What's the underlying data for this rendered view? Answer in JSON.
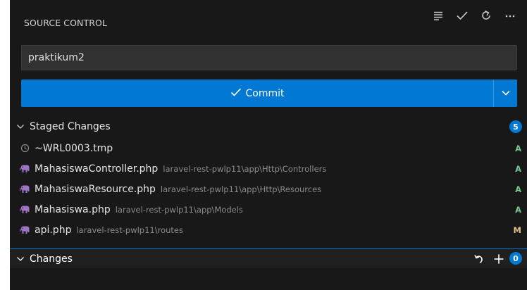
{
  "header": {
    "title": "SOURCE CONTROL",
    "actions": [
      "view-as-list-icon",
      "commit-check-icon",
      "refresh-icon",
      "more-actions-icon"
    ]
  },
  "commit_message": {
    "value": "praktikum2",
    "placeholder": ""
  },
  "commit_button": {
    "label": "Commit"
  },
  "staged": {
    "label": "Staged Changes",
    "count": "5",
    "files": [
      {
        "name": "~WRL0003.tmp",
        "path": "",
        "status": "A",
        "icon": "clock-file-icon"
      },
      {
        "name": "MahasiswaController.php",
        "path": "laravel-rest-pwlp11\\app\\Http\\Controllers",
        "status": "A",
        "icon": "php-elephant-icon"
      },
      {
        "name": "MahasiswaResource.php",
        "path": "laravel-rest-pwlp11\\app\\Http\\Resources",
        "status": "A",
        "icon": "php-elephant-icon"
      },
      {
        "name": "Mahasiswa.php",
        "path": "laravel-rest-pwlp11\\app\\Models",
        "status": "A",
        "icon": "php-elephant-icon"
      },
      {
        "name": "api.php",
        "path": "laravel-rest-pwlp11\\routes",
        "status": "M",
        "icon": "php-elephant-icon"
      }
    ]
  },
  "changes": {
    "label": "Changes",
    "count": "0"
  },
  "colors": {
    "accent": "#0078d4",
    "added": "#73c991",
    "modified": "#e2c08d",
    "php": "#a074c4"
  }
}
